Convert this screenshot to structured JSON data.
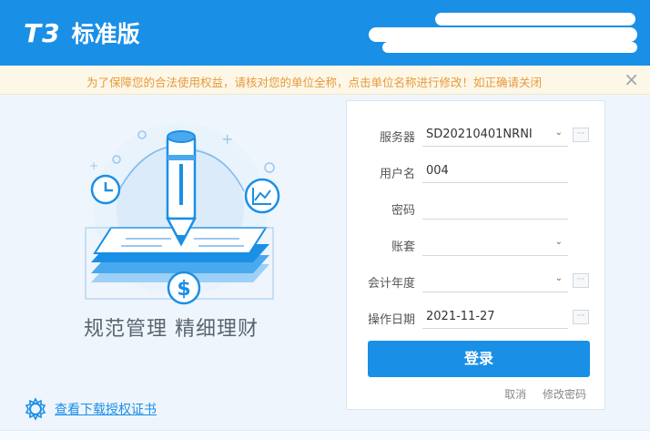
{
  "header": {
    "logo_mark": "T3",
    "product_name": "标准版"
  },
  "notice": {
    "text": "为了保障您的合法使用权益，请核对您的单位全称，点击单位名称进行修改！如正确请关闭",
    "close_glyph": "×"
  },
  "left": {
    "slogan": "规范管理  精细理财",
    "cert_link": "查看下载授权证书"
  },
  "form": {
    "server": {
      "label": "服务器",
      "value": "SD20210401NRNI"
    },
    "username": {
      "label": "用户名",
      "value": "004"
    },
    "password": {
      "label": "密码",
      "value": ""
    },
    "account_set": {
      "label": "账套",
      "value": ""
    },
    "fiscal_year": {
      "label": "会计年度",
      "value": ""
    },
    "operation_date": {
      "label": "操作日期",
      "value": "2021-11-27"
    },
    "more_glyph": "···",
    "dropdown_glyph": "⌄",
    "login_button": "登录",
    "cancel_link": "取消",
    "change_password_link": "修改密码"
  },
  "colors": {
    "brand": "#1a8fe6",
    "notice_text": "#e79a3a"
  }
}
